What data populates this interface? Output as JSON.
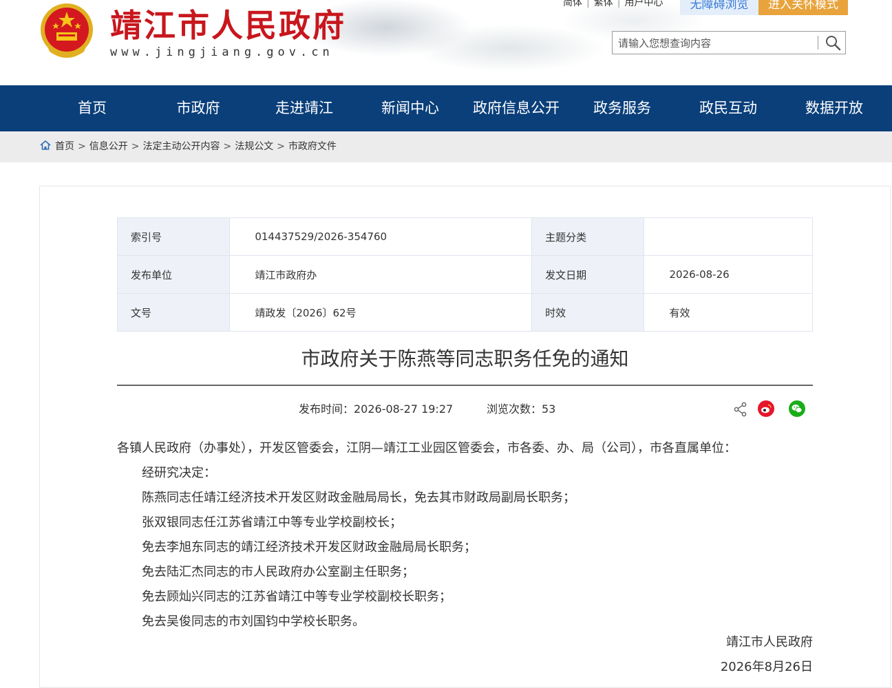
{
  "header": {
    "site_title": "靖江市人民政府",
    "site_url": "www.jingjiang.gov.cn",
    "lang_simplified": "简体",
    "lang_traditional": "繁体",
    "user_center": "用户中心",
    "accessibility": "无障碍浏览",
    "elder_mode": "进入关怀模式",
    "search_placeholder": "请输入您想查询内容",
    "brand_red": "#c8161d"
  },
  "nav": {
    "items": [
      "首页",
      "市政府",
      "走进靖江",
      "新闻中心",
      "政府信息公开",
      "政务服务",
      "政民互动",
      "数据开放"
    ],
    "background": "#0a3f7a"
  },
  "breadcrumb": [
    "首页",
    "信息公开",
    "法定主动公开内容",
    "法规公文",
    "市政府文件"
  ],
  "meta": {
    "index_label": "索引号",
    "index_value": "014437529/2026-354760",
    "topic_label": "主题分类",
    "topic_value": "",
    "publisher_label": "发布单位",
    "publisher_value": "靖江市政府办",
    "date_label": "发文日期",
    "date_value": "2026-08-26",
    "doc_no_label": "文号",
    "doc_no_value": "靖政发〔2026〕62号",
    "validity_label": "时效",
    "validity_value": "有效"
  },
  "article": {
    "title": "市政府关于陈燕等同志职务任免的通知",
    "publish_time": "发布时间：2026-08-27 19:27",
    "views": "浏览次数：53",
    "salutation": "各镇人民政府（办事处），开发区管委会，江阴—靖江工业园区管委会，市各委、办、局（公司），市各直属单位：",
    "paragraphs": [
      "经研究决定：",
      "陈燕同志任靖江经济技术开发区财政金融局局长，免去其市财政局副局长职务；",
      "张双银同志任江苏省靖江中等专业学校副校长；",
      "免去李旭东同志的靖江经济技术开发区财政金融局局长职务；",
      "免去陆汇杰同志的市人民政府办公室副主任职务；",
      "免去顾灿兴同志的江苏省靖江中等专业学校副校长职务；",
      "免去吴俊同志的市刘国钧中学校长职务。"
    ],
    "signature": "靖江市人民政府",
    "sign_date": "2026年8月26日"
  },
  "icons": {
    "share": "share-icon",
    "weibo": "weibo-icon",
    "wechat": "wechat-icon",
    "search": "search-icon",
    "home": "home-icon"
  }
}
